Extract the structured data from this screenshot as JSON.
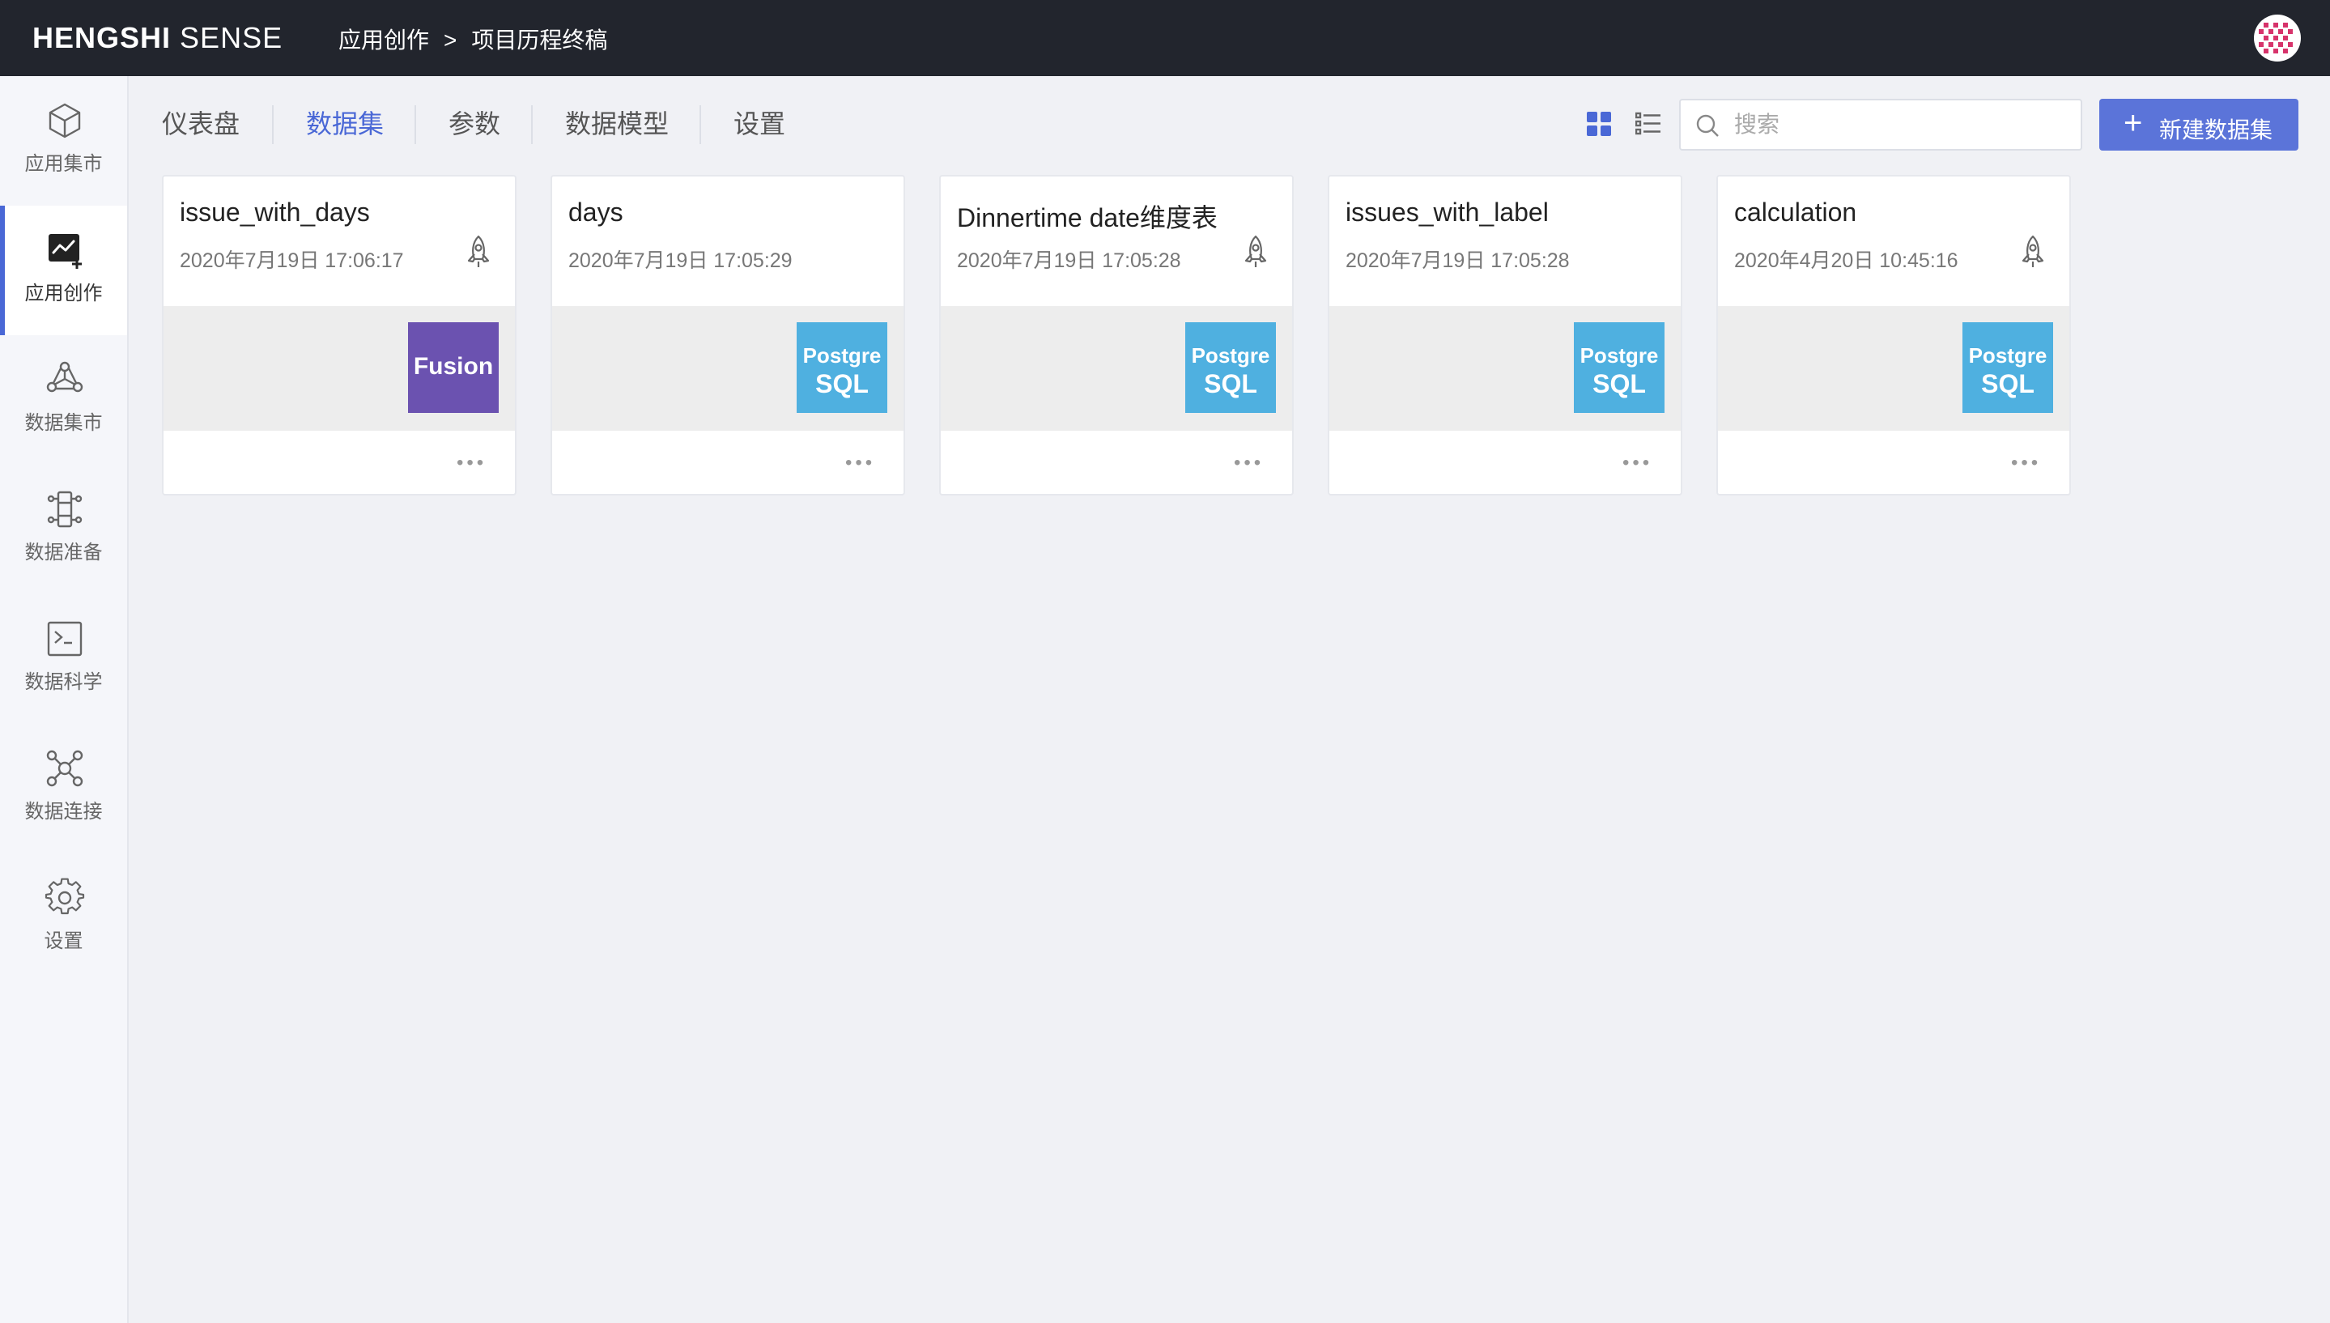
{
  "topbar": {
    "logo_bold": "HENGSHI",
    "logo_light": "SENSE",
    "breadcrumb": [
      "应用创作",
      "项目历程终稿"
    ],
    "breadcrumb_sep": ">"
  },
  "sidebar": {
    "items": [
      {
        "label": "应用集市",
        "icon": "cube-icon"
      },
      {
        "label": "应用创作",
        "icon": "chart-edit-icon",
        "active": true
      },
      {
        "label": "数据集市",
        "icon": "network-icon"
      },
      {
        "label": "数据准备",
        "icon": "pipeline-icon"
      },
      {
        "label": "数据科学",
        "icon": "terminal-icon"
      },
      {
        "label": "数据连接",
        "icon": "connection-icon"
      },
      {
        "label": "设置",
        "icon": "gear-icon"
      }
    ]
  },
  "tabs": [
    {
      "label": "仪表盘"
    },
    {
      "label": "数据集",
      "active": true
    },
    {
      "label": "参数"
    },
    {
      "label": "数据模型"
    },
    {
      "label": "设置"
    }
  ],
  "toolbar": {
    "search_placeholder": "搜索",
    "search_value": "",
    "new_button_icon": "+",
    "new_button_label": "新建数据集",
    "view_mode": "grid"
  },
  "datasets": [
    {
      "name": "issue_with_days",
      "date": "2020年7月19日 17:06:17",
      "source": "fusion",
      "source_text": [
        "Fusion"
      ],
      "rocket": true
    },
    {
      "name": "days",
      "date": "2020年7月19日 17:05:29",
      "source": "postgresql",
      "source_text": [
        "Postgre",
        "SQL"
      ],
      "rocket": false
    },
    {
      "name": "Dinnertime date维度表",
      "date": "2020年7月19日 17:05:28",
      "source": "postgresql",
      "source_text": [
        "Postgre",
        "SQL"
      ],
      "rocket": true
    },
    {
      "name": "issues_with_label",
      "date": "2020年7月19日 17:05:28",
      "source": "postgresql",
      "source_text": [
        "Postgre",
        "SQL"
      ],
      "rocket": false
    },
    {
      "name": "calculation",
      "date": "2020年4月20日 10:45:16",
      "source": "postgresql",
      "source_text": [
        "Postgre",
        "SQL"
      ],
      "rocket": true
    }
  ],
  "colors": {
    "accent": "#4a68d6",
    "button": "#5b74d9",
    "topbar": "#22252d",
    "fusion": "#6b52b0",
    "postgresql": "#4fb0e0"
  }
}
